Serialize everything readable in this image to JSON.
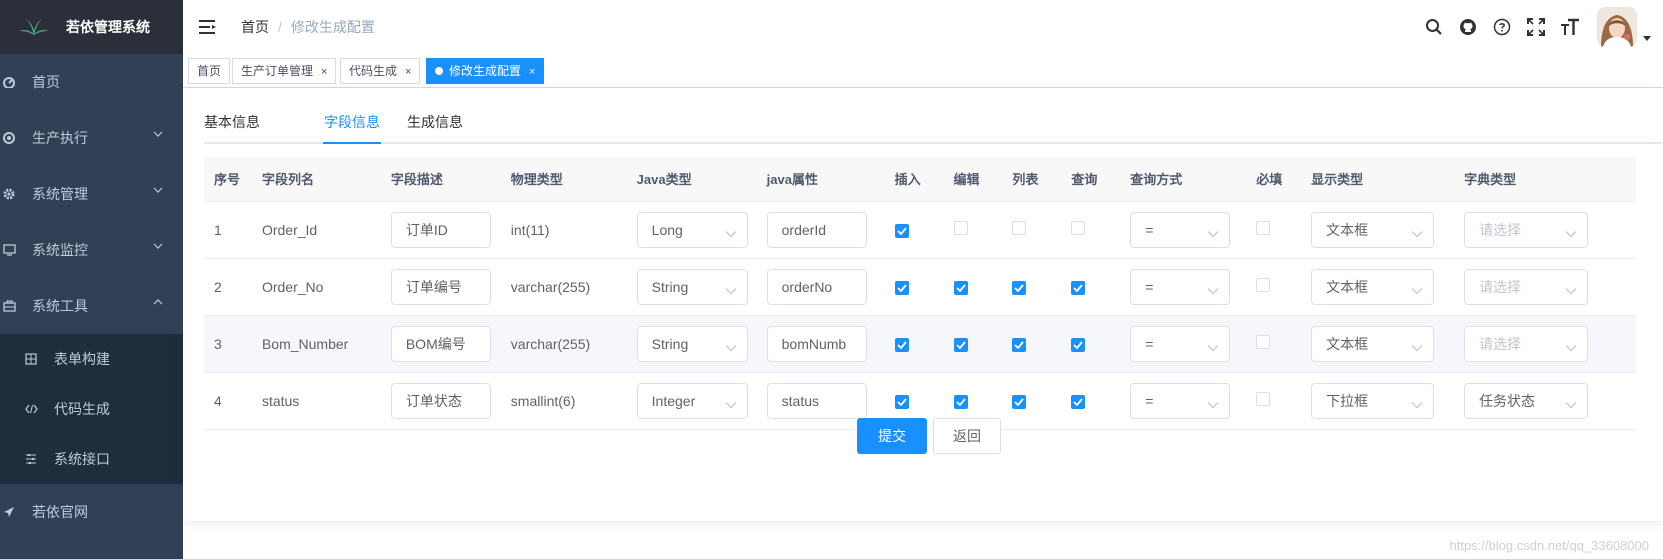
{
  "sidebar": {
    "title": "若依管理系统",
    "items": [
      {
        "label": "首页",
        "icon": "dashboard-icon"
      },
      {
        "label": "生产执行",
        "icon": "lifebuoy-icon"
      },
      {
        "label": "系统管理",
        "icon": "gear-icon"
      },
      {
        "label": "系统监控",
        "icon": "monitor-icon"
      },
      {
        "label": "系统工具",
        "icon": "toolbox-icon"
      }
    ],
    "subitems": [
      {
        "label": "表单构建",
        "icon": "form-icon"
      },
      {
        "label": "代码生成",
        "icon": "code-icon"
      },
      {
        "label": "系统接口",
        "icon": "sliders-icon"
      }
    ],
    "last": {
      "label": "若依官网",
      "icon": "send-icon"
    }
  },
  "breadcrumb": {
    "home": "首页",
    "sep": "/",
    "current": "修改生成配置"
  },
  "tagsview": [
    "首页",
    "生产订单管理",
    "代码生成",
    "修改生成配置"
  ],
  "tabs": [
    "基本信息",
    "字段信息",
    "生成信息"
  ],
  "table": {
    "headers": [
      "序号",
      "字段列名",
      "字段描述",
      "物理类型",
      "Java类型",
      "java属性",
      "插入",
      "编辑",
      "列表",
      "查询",
      "查询方式",
      "必填",
      "显示类型",
      "字典类型"
    ],
    "rows": [
      {
        "no": "1",
        "column": "Order_Id",
        "desc": "订单ID",
        "ptype": "int(11)",
        "jtype": "Long",
        "prop": "orderId",
        "insert": true,
        "edit": false,
        "list": false,
        "query": false,
        "qmode": "=",
        "required": false,
        "html": "文本框",
        "dict": "请选择"
      },
      {
        "no": "2",
        "column": "Order_No",
        "desc": "订单编号",
        "ptype": "varchar(255)",
        "jtype": "String",
        "prop": "orderNo",
        "insert": true,
        "edit": true,
        "list": true,
        "query": true,
        "qmode": "=",
        "required": false,
        "html": "文本框",
        "dict": "请选择"
      },
      {
        "no": "3",
        "column": "Bom_Number",
        "desc": "BOM编号",
        "ptype": "varchar(255)",
        "jtype": "String",
        "prop": "bomNumb",
        "insert": true,
        "edit": true,
        "list": true,
        "query": true,
        "qmode": "=",
        "required": false,
        "html": "文本框",
        "dict": "请选择"
      },
      {
        "no": "4",
        "column": "status",
        "desc": "订单状态",
        "ptype": "smallint(6)",
        "jtype": "Integer",
        "prop": "status",
        "insert": true,
        "edit": true,
        "list": true,
        "query": true,
        "qmode": "=",
        "required": false,
        "html": "下拉框",
        "dict": "任务状态"
      }
    ]
  },
  "buttons": {
    "submit": "提交",
    "back": "返回"
  },
  "watermark": "https://blog.csdn.net/qq_33608000",
  "colors": {
    "primary": "#1890ff",
    "sidebar": "#304156",
    "sidebar_dark": "#1f2d3d"
  }
}
